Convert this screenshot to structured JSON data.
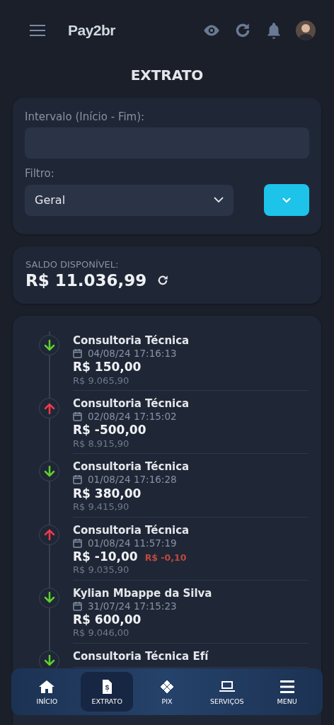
{
  "header": {
    "logo": "Pay2br"
  },
  "title": "EXTRATO",
  "filters": {
    "interval_label": "Intervalo (Início - Fim):",
    "filter_label": "Filtro:",
    "filter_value": "Geral"
  },
  "balance": {
    "label": "SALDO DISPONÍVEL:",
    "value": "R$ 11.036,99"
  },
  "transactions": [
    {
      "kind": "in",
      "name": "Consultoria Técnica",
      "date": "04/08/24 17:16:13",
      "amount": "R$ 150,00",
      "balance": "R$ 9.065,90"
    },
    {
      "kind": "out",
      "name": "Consultoria Técnica",
      "date": "02/08/24 17:15:02",
      "amount": "R$ -500,00",
      "balance": "R$ 8.915,90"
    },
    {
      "kind": "in",
      "name": "Consultoria Técnica",
      "date": "01/08/24 17:16:28",
      "amount": "R$ 380,00",
      "balance": "R$ 9.415,90"
    },
    {
      "kind": "out",
      "name": "Consultoria Técnica",
      "date": "01/08/24 11:57:19",
      "amount": "R$ -10,00",
      "fee": "R$ -0,10",
      "balance": "R$ 9.035,90"
    },
    {
      "kind": "in",
      "name": "Kylian Mbappe da Silva",
      "date": "31/07/24 17:15:23",
      "amount": "R$ 600,00",
      "balance": "R$ 9.046,00"
    },
    {
      "kind": "in",
      "name": "Consultoria Técnica Efí"
    }
  ],
  "nav": [
    {
      "kind": "home",
      "label": "INÍCIO",
      "selected": false
    },
    {
      "kind": "statement",
      "label": "EXTRATO",
      "selected": true
    },
    {
      "kind": "pix",
      "label": "PIX",
      "selected": false
    },
    {
      "kind": "services",
      "label": "SERVIÇOS",
      "selected": false
    },
    {
      "kind": "menu",
      "label": "MENU",
      "selected": false
    }
  ]
}
